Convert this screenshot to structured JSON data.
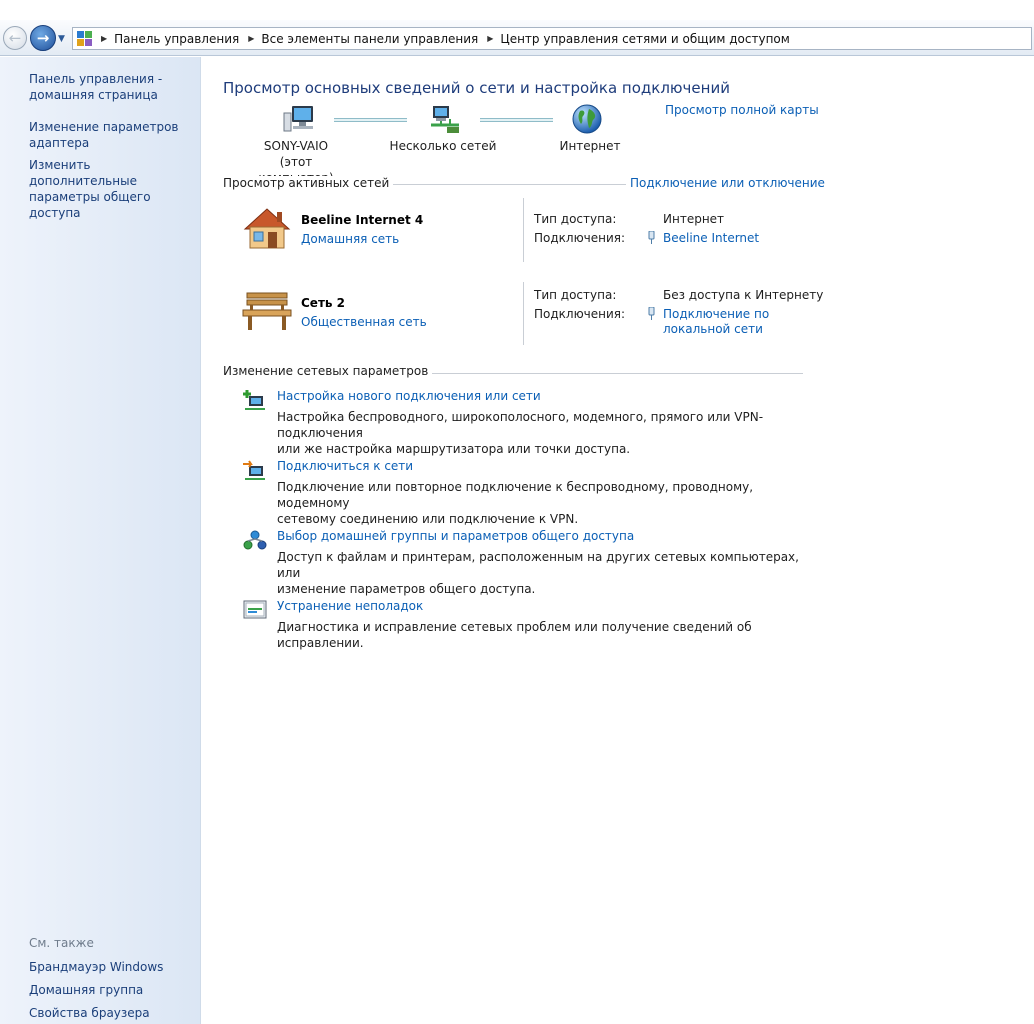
{
  "address_bar": {
    "breadcrumbs": [
      "Панель управления",
      "Все элементы панели управления",
      "Центр управления сетями и общим доступом"
    ]
  },
  "sidebar": {
    "items": [
      {
        "label": "Панель управления - домашняя страница"
      },
      {
        "label": "Изменение параметров адаптера"
      },
      {
        "label": "Изменить дополнительные параметры общего доступа"
      }
    ],
    "see_also_label": "См. также",
    "see_also": [
      {
        "label": "Брандмауэр Windows"
      },
      {
        "label": "Домашняя группа"
      },
      {
        "label": "Свойства браузера"
      }
    ]
  },
  "main": {
    "title": "Просмотр основных сведений о сети и настройка подключений",
    "full_map_link": "Просмотр полной карты",
    "network_map": {
      "nodes": [
        {
          "label": "SONY-VAIO",
          "sublabel": "(этот компьютер)",
          "icon": "computer-icon"
        },
        {
          "label": "Несколько сетей",
          "icon": "multiple-networks-icon"
        },
        {
          "label": "Интернет",
          "icon": "globe-icon"
        }
      ]
    },
    "active_networks": {
      "header": "Просмотр активных сетей",
      "connect_link": "Подключение или отключение",
      "access_type_label": "Тип доступа:",
      "connections_label": "Подключения:",
      "networks": [
        {
          "name": "Beeline Internet  4",
          "type": "Домашняя сеть",
          "icon": "house-icon",
          "access": "Интернет",
          "connection": "Beeline Internet"
        },
        {
          "name": "Сеть  2",
          "type": "Общественная сеть",
          "icon": "bench-icon",
          "access": "Без доступа к Интернету",
          "connection_line1": "Подключение по",
          "connection_line2": "локальной сети"
        }
      ]
    },
    "change_settings": {
      "header": "Изменение сетевых параметров",
      "tasks": [
        {
          "title": "Настройка нового подключения или сети",
          "desc_line1": "Настройка беспроводного, широкополосного, модемного, прямого или VPN-подключения",
          "desc_line2": "или же настройка маршрутизатора или точки доступа.",
          "icon": "new-connection-icon"
        },
        {
          "title": "Подключиться к сети",
          "desc_line1": "Подключение или повторное подключение к беспроводному, проводному, модемному",
          "desc_line2": "сетевому соединению или подключение к VPN.",
          "icon": "connect-network-icon"
        },
        {
          "title": "Выбор домашней группы и параметров общего доступа",
          "desc_line1": "Доступ к файлам и принтерам, расположенным на других сетевых компьютерах, или",
          "desc_line2": "изменение параметров общего доступа.",
          "icon": "homegroup-icon"
        },
        {
          "title": "Устранение неполадок",
          "desc_line1": "Диагностика и исправление сетевых проблем или получение сведений об исправлении.",
          "icon": "troubleshoot-icon"
        }
      ]
    }
  },
  "colors": {
    "link": "#0b5fb5",
    "title": "#1e3c7b",
    "sidebar_link": "#1b3f7a"
  }
}
